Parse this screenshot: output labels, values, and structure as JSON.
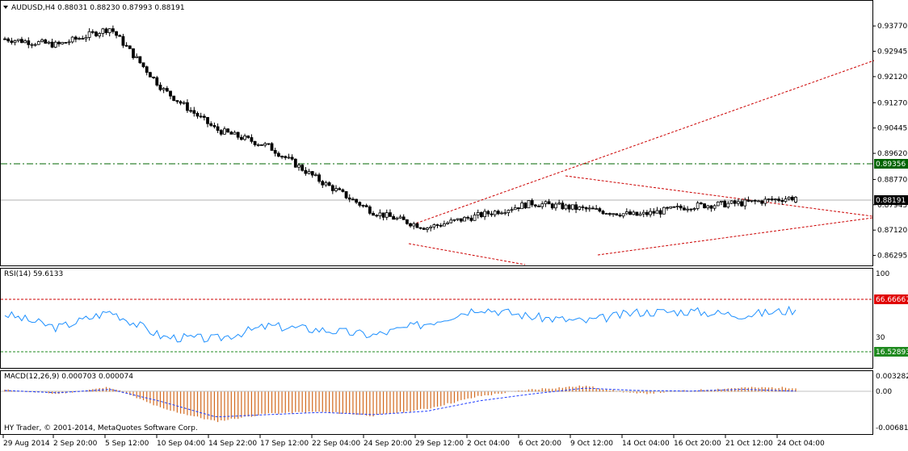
{
  "main": {
    "header": "AUDUSD,H4  0.88031 0.88230 0.87993 0.88191",
    "y_ticks": [
      "0.93770",
      "0.92945",
      "0.92120",
      "0.91270",
      "0.90445",
      "0.89620",
      "0.88770",
      "0.87945",
      "0.87120",
      "0.86295"
    ],
    "hline_green_label": "0.89356",
    "price_label": "0.88191"
  },
  "rsi": {
    "header": "RSI(14) 59.6133",
    "top_label": "100",
    "mid_label": "30",
    "overbought_label": "66.66667",
    "oversold_label": "16.52893"
  },
  "macd": {
    "header": "MACD(12,26,9) 0.000703 0.000074",
    "top_label": "0.003282",
    "zero_label": "0.00",
    "bottom_label": "-0.006814"
  },
  "copyright": "HY Trader, © 2001-2014, MetaQuotes Software Corp.",
  "x_ticks": [
    "29 Aug 2014",
    "2 Sep 20:00",
    "5 Sep 12:00",
    "10 Sep 04:00",
    "14 Sep 22:00",
    "17 Sep 12:00",
    "22 Sep 04:00",
    "24 Sep 20:00",
    "29 Sep 12:00",
    "2 Oct 04:00",
    "6 Oct 20:00",
    "9 Oct 12:00",
    "14 Oct 04:00",
    "16 Oct 20:00",
    "21 Oct 12:00",
    "24 Oct 04:00"
  ],
  "colors": {
    "bull_candle": "#ffffff",
    "bear_candle": "#000000",
    "trendline": "#cc0000",
    "support_line": "#006400",
    "rsi_line": "#1e90ff",
    "macd_hist": "#d2691e",
    "macd_signal": "#1e3cff",
    "price_tag": "#000000",
    "overbought_tag": "#e00000",
    "oversold_tag": "#1f8a1f"
  },
  "chart_data": [
    {
      "type": "candlestick",
      "title": "AUDUSD,H4",
      "x": [
        "29 Aug 2014",
        "2 Sep 20:00",
        "5 Sep 12:00",
        "10 Sep 04:00",
        "14 Sep 22:00",
        "17 Sep 12:00",
        "22 Sep 04:00",
        "24 Sep 20:00",
        "29 Sep 12:00",
        "2 Oct 04:00",
        "6 Oct 20:00",
        "9 Oct 12:00",
        "14 Oct 04:00",
        "16 Oct 20:00",
        "21 Oct 12:00",
        "24 Oct 04:00"
      ],
      "close": [
        0.9335,
        0.9315,
        0.937,
        0.917,
        0.904,
        0.8985,
        0.887,
        0.877,
        0.872,
        0.876,
        0.88,
        0.878,
        0.876,
        0.879,
        0.88,
        0.8819
      ],
      "last": {
        "open": 0.88031,
        "high": 0.8823,
        "low": 0.87993,
        "close": 0.88191
      },
      "hlines": [
        {
          "value": 0.89356,
          "style": "dash-dot",
          "color": "green"
        },
        {
          "value": 0.88191,
          "style": "solid",
          "color": "gray"
        }
      ],
      "ylim": [
        0.861,
        0.943
      ],
      "grid": false
    },
    {
      "type": "line",
      "title": "RSI(14) 59.6133",
      "x": [
        "29 Aug 2014",
        "2 Sep 20:00",
        "5 Sep 12:00",
        "10 Sep 04:00",
        "14 Sep 22:00",
        "17 Sep 12:00",
        "22 Sep 04:00",
        "24 Sep 20:00",
        "29 Sep 12:00",
        "2 Oct 04:00",
        "6 Oct 20:00",
        "9 Oct 12:00",
        "14 Oct 04:00",
        "16 Oct 20:00",
        "21 Oct 12:00",
        "24 Oct 04:00"
      ],
      "values": [
        55,
        40,
        58,
        30,
        28,
        42,
        38,
        32,
        45,
        62,
        52,
        47,
        57,
        58,
        54,
        59.6
      ],
      "levels": [
        66.66667,
        16.52893
      ],
      "ylim": [
        0,
        100
      ]
    },
    {
      "type": "bar",
      "title": "MACD(12,26,9) 0.000703 0.000074",
      "x": [
        "29 Aug 2014",
        "2 Sep 20:00",
        "5 Sep 12:00",
        "10 Sep 04:00",
        "14 Sep 22:00",
        "17 Sep 12:00",
        "22 Sep 04:00",
        "24 Sep 20:00",
        "29 Sep 12:00",
        "2 Oct 04:00",
        "6 Oct 20:00",
        "9 Oct 12:00",
        "14 Oct 04:00",
        "16 Oct 20:00",
        "21 Oct 12:00",
        "24 Oct 04:00"
      ],
      "series": [
        {
          "values": [
            0.0003,
            -0.0004,
            0.0008,
            -0.003,
            -0.0052,
            -0.0038,
            -0.0035,
            -0.0042,
            -0.003,
            -0.0008,
            0.0004,
            0.001,
            -0.0004,
            0.0002,
            0.0007,
            0.0007
          ]
        },
        {
          "values": [
            0.0002,
            -0.0002,
            0.0004,
            -0.0018,
            -0.0044,
            -0.004,
            -0.0036,
            -0.004,
            -0.0034,
            -0.0016,
            -0.0004,
            0.0006,
            0.0002,
            0.0001,
            0.0004,
            0.0001
          ]
        }
      ],
      "ylim": [
        -0.006814,
        0.003282
      ]
    }
  ]
}
